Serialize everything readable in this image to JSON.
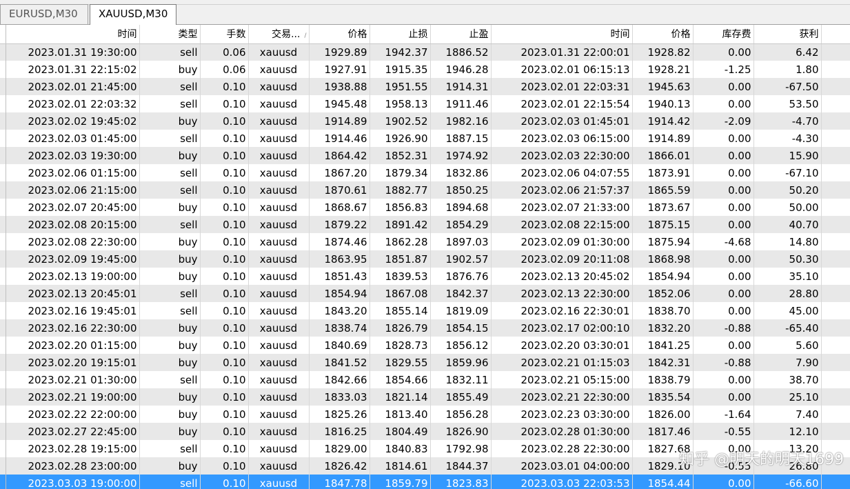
{
  "tabs": [
    {
      "label": "EURUSD,M30",
      "active": false
    },
    {
      "label": "XAUUSD,M30",
      "active": true
    }
  ],
  "columns": [
    "时间",
    "类型",
    "手数",
    "交易...",
    "价格",
    "止损",
    "止盈",
    "时间",
    "价格",
    "库存费",
    "获利"
  ],
  "rows": [
    [
      "2023.01.31 19:30:00",
      "sell",
      "0.06",
      "xauusd",
      "1929.89",
      "1942.37",
      "1886.52",
      "2023.01.31 22:00:01",
      "1928.82",
      "0.00",
      "6.42"
    ],
    [
      "2023.01.31 22:15:02",
      "buy",
      "0.06",
      "xauusd",
      "1927.91",
      "1915.35",
      "1946.28",
      "2023.02.01 06:15:13",
      "1928.21",
      "-1.25",
      "1.80"
    ],
    [
      "2023.02.01 21:45:00",
      "sell",
      "0.10",
      "xauusd",
      "1938.88",
      "1951.55",
      "1914.31",
      "2023.02.01 22:03:31",
      "1945.63",
      "0.00",
      "-67.50"
    ],
    [
      "2023.02.01 22:03:32",
      "sell",
      "0.10",
      "xauusd",
      "1945.48",
      "1958.13",
      "1911.46",
      "2023.02.01 22:15:54",
      "1940.13",
      "0.00",
      "53.50"
    ],
    [
      "2023.02.02 19:45:02",
      "buy",
      "0.10",
      "xauusd",
      "1914.89",
      "1902.52",
      "1982.16",
      "2023.02.03 01:45:01",
      "1914.42",
      "-2.09",
      "-4.70"
    ],
    [
      "2023.02.03 01:45:00",
      "sell",
      "0.10",
      "xauusd",
      "1914.46",
      "1926.90",
      "1887.15",
      "2023.02.03 06:15:00",
      "1914.89",
      "0.00",
      "-4.30"
    ],
    [
      "2023.02.03 19:30:00",
      "buy",
      "0.10",
      "xauusd",
      "1864.42",
      "1852.31",
      "1974.92",
      "2023.02.03 22:30:00",
      "1866.01",
      "0.00",
      "15.90"
    ],
    [
      "2023.02.06 01:15:00",
      "sell",
      "0.10",
      "xauusd",
      "1867.20",
      "1879.34",
      "1832.86",
      "2023.02.06 04:07:55",
      "1873.91",
      "0.00",
      "-67.10"
    ],
    [
      "2023.02.06 21:15:00",
      "sell",
      "0.10",
      "xauusd",
      "1870.61",
      "1882.77",
      "1850.25",
      "2023.02.06 21:57:37",
      "1865.59",
      "0.00",
      "50.20"
    ],
    [
      "2023.02.07 20:45:00",
      "buy",
      "0.10",
      "xauusd",
      "1868.67",
      "1856.83",
      "1894.68",
      "2023.02.07 21:33:00",
      "1873.67",
      "0.00",
      "50.00"
    ],
    [
      "2023.02.08 20:15:00",
      "sell",
      "0.10",
      "xauusd",
      "1879.22",
      "1891.42",
      "1854.29",
      "2023.02.08 22:15:00",
      "1875.15",
      "0.00",
      "40.70"
    ],
    [
      "2023.02.08 22:30:00",
      "buy",
      "0.10",
      "xauusd",
      "1874.46",
      "1862.28",
      "1897.03",
      "2023.02.09 01:30:00",
      "1875.94",
      "-4.68",
      "14.80"
    ],
    [
      "2023.02.09 19:45:00",
      "buy",
      "0.10",
      "xauusd",
      "1863.95",
      "1851.87",
      "1902.57",
      "2023.02.09 20:11:08",
      "1868.98",
      "0.00",
      "50.30"
    ],
    [
      "2023.02.13 19:00:00",
      "buy",
      "0.10",
      "xauusd",
      "1851.43",
      "1839.53",
      "1876.76",
      "2023.02.13 20:45:02",
      "1854.94",
      "0.00",
      "35.10"
    ],
    [
      "2023.02.13 20:45:01",
      "sell",
      "0.10",
      "xauusd",
      "1854.94",
      "1867.08",
      "1842.37",
      "2023.02.13 22:30:00",
      "1852.06",
      "0.00",
      "28.80"
    ],
    [
      "2023.02.16 19:45:01",
      "sell",
      "0.10",
      "xauusd",
      "1843.20",
      "1855.14",
      "1819.09",
      "2023.02.16 22:30:01",
      "1838.70",
      "0.00",
      "45.00"
    ],
    [
      "2023.02.16 22:30:00",
      "buy",
      "0.10",
      "xauusd",
      "1838.74",
      "1826.79",
      "1854.15",
      "2023.02.17 02:00:10",
      "1832.20",
      "-0.88",
      "-65.40"
    ],
    [
      "2023.02.20 01:15:00",
      "buy",
      "0.10",
      "xauusd",
      "1840.69",
      "1828.73",
      "1856.12",
      "2023.02.20 03:30:01",
      "1841.25",
      "0.00",
      "5.60"
    ],
    [
      "2023.02.20 19:15:01",
      "buy",
      "0.10",
      "xauusd",
      "1841.52",
      "1829.55",
      "1859.96",
      "2023.02.21 01:15:03",
      "1842.31",
      "-0.88",
      "7.90"
    ],
    [
      "2023.02.21 01:30:00",
      "sell",
      "0.10",
      "xauusd",
      "1842.66",
      "1854.66",
      "1832.11",
      "2023.02.21 05:15:00",
      "1838.79",
      "0.00",
      "38.70"
    ],
    [
      "2023.02.21 19:00:00",
      "buy",
      "0.10",
      "xauusd",
      "1833.03",
      "1821.14",
      "1855.49",
      "2023.02.21 22:30:00",
      "1835.54",
      "0.00",
      "25.10"
    ],
    [
      "2023.02.22 22:00:00",
      "buy",
      "0.10",
      "xauusd",
      "1825.26",
      "1813.40",
      "1856.28",
      "2023.02.23 03:30:00",
      "1826.00",
      "-1.64",
      "7.40"
    ],
    [
      "2023.02.27 22:45:00",
      "buy",
      "0.10",
      "xauusd",
      "1816.25",
      "1804.49",
      "1826.90",
      "2023.02.28 01:30:00",
      "1817.46",
      "-0.55",
      "12.10"
    ],
    [
      "2023.02.28 19:15:00",
      "sell",
      "0.10",
      "xauusd",
      "1829.00",
      "1840.83",
      "1792.98",
      "2023.02.28 22:30:00",
      "1827.68",
      "0.00",
      "13.20"
    ],
    [
      "2023.02.28 23:00:00",
      "buy",
      "0.10",
      "xauusd",
      "1826.42",
      "1814.61",
      "1844.37",
      "2023.03.01 04:00:00",
      "1829.10",
      "-0.55",
      "26.80"
    ],
    [
      "2023.03.03 19:00:00",
      "sell",
      "0.10",
      "xauusd",
      "1847.78",
      "1859.79",
      "1823.83",
      "2023.03.03 22:03:53",
      "1854.44",
      "0.00",
      "-66.60"
    ]
  ],
  "selected_row": 25,
  "watermark": "知乎 @明天的明天1699",
  "colors": {
    "selection": "#3399ff",
    "alt_row": "#e8e8e8"
  }
}
